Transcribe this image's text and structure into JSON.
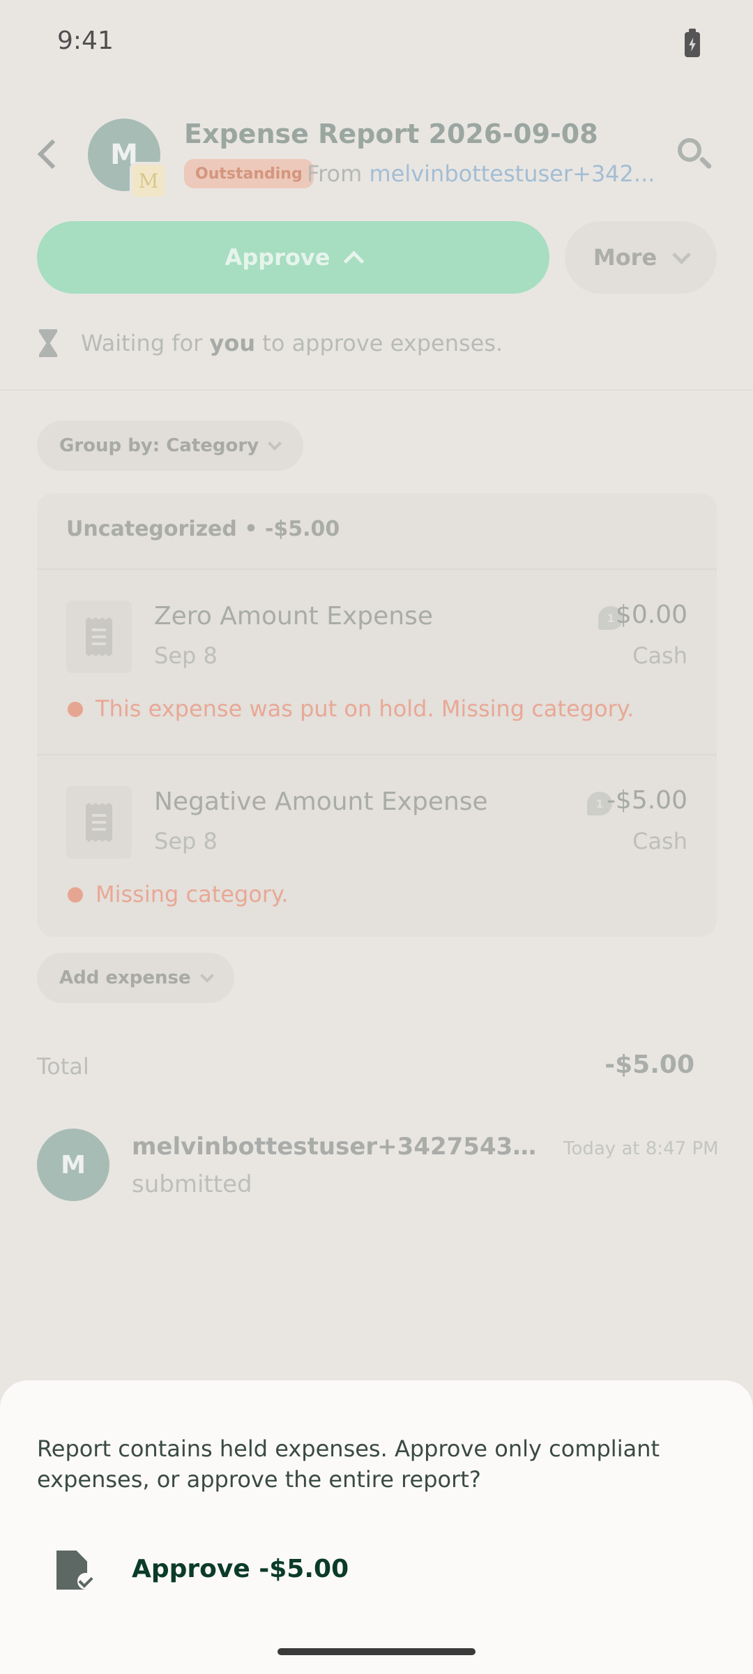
{
  "status_bar": {
    "time": "9:41"
  },
  "header": {
    "avatar_letter": "M",
    "workspace_letter": "M",
    "title": "Expense Report 2026-09-08",
    "status_badge": "Outstanding",
    "from_prefix": "From",
    "from_user": "melvinbottestuser+342..."
  },
  "actions": {
    "approve_label": "Approve",
    "more_label": "More"
  },
  "waiting": {
    "prefix": "Waiting for",
    "who": "you",
    "suffix": "to approve expenses."
  },
  "group_by": {
    "label": "Group by: Category"
  },
  "category_group": {
    "header": "Uncategorized • -$5.00",
    "expenses": [
      {
        "title": "Zero Amount Expense",
        "date": "Sep 8",
        "amount": "$0.00",
        "method": "Cash",
        "comment_count": "1",
        "violation": "This expense was put on hold. Missing category."
      },
      {
        "title": "Negative Amount Expense",
        "date": "Sep 8",
        "amount": "-$5.00",
        "method": "Cash",
        "comment_count": "1",
        "violation": "Missing category."
      }
    ]
  },
  "add_expense": {
    "label": "Add expense"
  },
  "total": {
    "label": "Total",
    "value": "-$5.00"
  },
  "activity": {
    "avatar_letter": "M",
    "actor": "melvinbottestuser+3427543987...",
    "timestamp": "Today at 8:47 PM",
    "action": "submitted"
  },
  "bottom_sheet": {
    "message": "Report contains held expenses. Approve only compliant expenses, or approve the entire report?",
    "option_label": "Approve -$5.00",
    "option_icon": "document-check-icon"
  },
  "colors": {
    "approve": "#a7ddc0",
    "badge_bg": "#ecc9ba",
    "violation": "#e8a896",
    "link": "#a3bdd4",
    "option_text": "#0b3b2a"
  }
}
